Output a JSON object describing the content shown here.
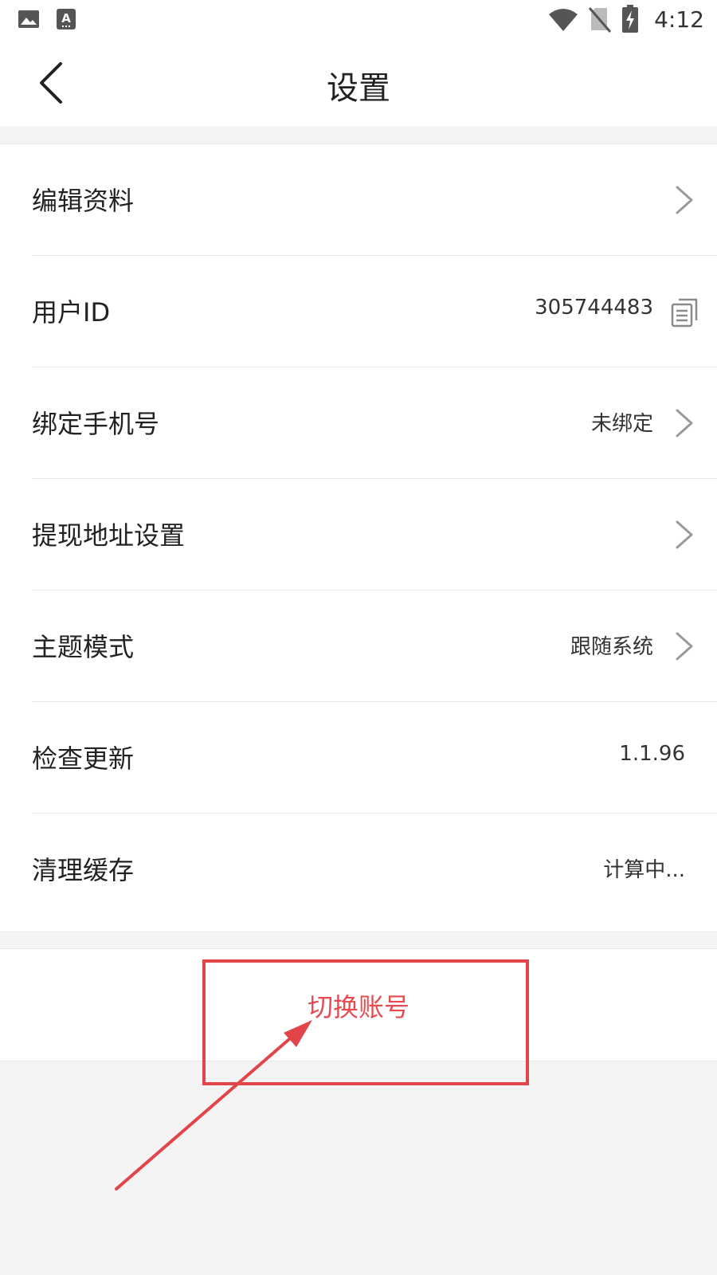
{
  "status_bar": {
    "time": "4:12",
    "icons": [
      "image-icon",
      "text-a-icon",
      "wifi-icon",
      "no-sim-icon",
      "battery-charging-icon"
    ]
  },
  "header": {
    "title": "设置",
    "back_icon": "chevron-left-icon"
  },
  "settings": {
    "items": [
      {
        "label": "编辑资料",
        "value": "",
        "icon": "chevron-right-icon"
      },
      {
        "label": "用户ID",
        "value": "305744483",
        "icon": "copy-icon"
      },
      {
        "label": "绑定手机号",
        "value": "未绑定",
        "icon": "chevron-right-icon"
      },
      {
        "label": "提现地址设置",
        "value": "",
        "icon": "chevron-right-icon"
      },
      {
        "label": "主题模式",
        "value": "跟随系统",
        "icon": "chevron-right-icon"
      },
      {
        "label": "检查更新",
        "value": "1.1.96",
        "icon": ""
      },
      {
        "label": "清理缓存",
        "value": "计算中...",
        "icon": ""
      }
    ]
  },
  "switch_account": {
    "label": "切换账号"
  },
  "colors": {
    "accent": "#e84a4f",
    "annotation": "#e24549",
    "background": "#f4f4f4"
  }
}
